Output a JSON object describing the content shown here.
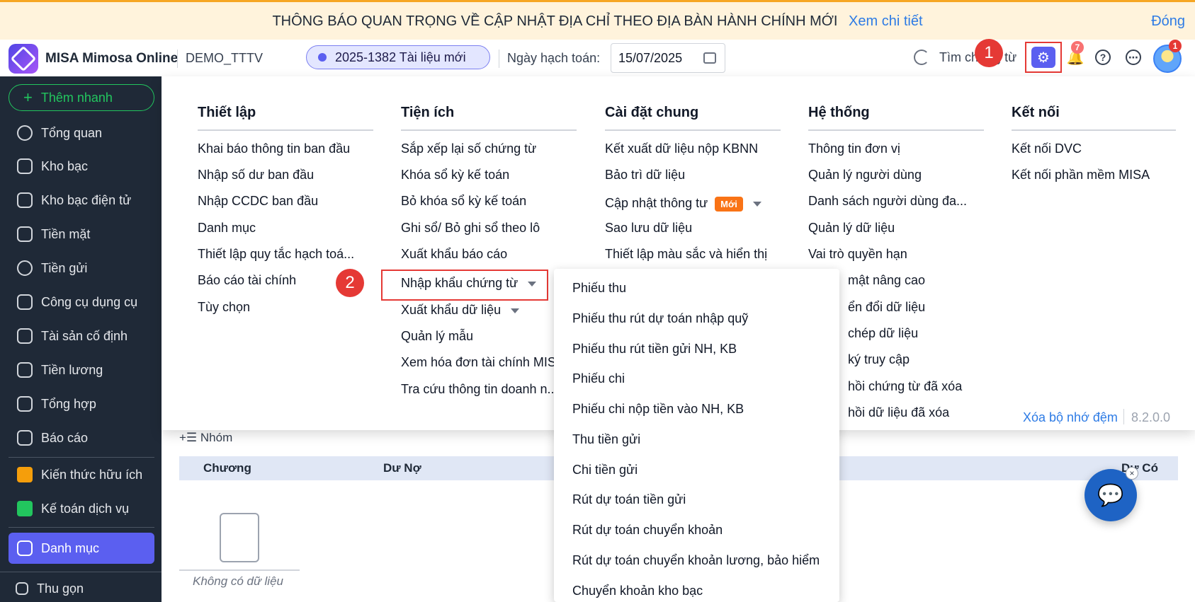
{
  "banner": {
    "message": "THÔNG BÁO QUAN TRỌNG VỀ CẬP NHẬT ĐỊA CHỈ THEO ĐỊA BÀN HÀNH CHÍNH MỚI",
    "link": "Xem chi tiết",
    "close": "Đóng"
  },
  "header": {
    "app_name": "MISA Mimosa Online",
    "database": "DEMO_TTTV",
    "doc_pill": "2025-1382 Tài liệu mới",
    "posting_date_label": "Ngày hạch toán:",
    "posting_date": "15/07/2025",
    "search_label": "Tìm chứng từ",
    "notification_count": "7",
    "avatar_count": "1",
    "step1": "1",
    "step2": "2"
  },
  "sidebar": {
    "add_quick": "Thêm nhanh",
    "items": [
      {
        "label": "Tổng quan"
      },
      {
        "label": "Kho bạc"
      },
      {
        "label": "Kho bạc điện tử"
      },
      {
        "label": "Tiền mặt"
      },
      {
        "label": "Tiền gửi"
      },
      {
        "label": "Công cụ dụng cụ"
      },
      {
        "label": "Tài sản cố định"
      },
      {
        "label": "Tiền lương"
      },
      {
        "label": "Tổng hợp"
      },
      {
        "label": "Báo cáo"
      },
      {
        "label": "Kiến thức hữu ích"
      },
      {
        "label": "Kế toán dịch vụ"
      },
      {
        "label": "Danh mục"
      }
    ],
    "collapse": "Thu gọn"
  },
  "background": {
    "group_label": "Nhóm",
    "columns": [
      "Chương",
      "Dư Nợ",
      "Dư Có"
    ],
    "empty_text": "Không có dữ liệu"
  },
  "settings_menu": {
    "columns": [
      {
        "title": "Thiết lập",
        "items": [
          "Khai báo thông tin ban đầu",
          "Nhập số dư ban đầu",
          "Nhập CCDC ban đầu",
          "Danh mục",
          "Thiết lập quy tắc hạch toá...",
          "Báo cáo tài chính",
          "Tùy chọn"
        ]
      },
      {
        "title": "Tiện ích",
        "items": [
          "Sắp xếp lại số chứng từ",
          "Khóa sổ kỳ kế toán",
          "Bỏ khóa sổ kỳ kế toán",
          "Ghi sổ/ Bỏ ghi sổ theo lô",
          "Xuất khẩu báo cáo",
          "Nhập khẩu chứng từ",
          "Xuất khẩu dữ liệu",
          "Quản lý mẫu",
          "Xem hóa đơn tài chính MIS",
          "Tra cứu thông tin doanh n..."
        ]
      },
      {
        "title": "Cài đặt chung",
        "items": [
          "Kết xuất dữ liệu nộp KBNN",
          "Bảo trì dữ liệu",
          "Cập nhật thông tư",
          "Sao lưu dữ liệu",
          "Thiết lập màu sắc và hiển thị"
        ],
        "new_tag": "Mới"
      },
      {
        "title": "Hệ thống",
        "items": [
          "Thông tin đơn vị",
          "Quản lý người dùng",
          "Danh sách người dùng đa...",
          "Quản lý dữ liệu",
          "Vai trò quyền hạn",
          "mật nâng cao",
          "ển đổi dữ liệu",
          "chép dữ liệu",
          "ký truy cập",
          "hồi chứng từ đã xóa",
          "hồi dữ liệu đã xóa"
        ]
      },
      {
        "title": "Kết nối",
        "items": [
          "Kết nối DVC",
          "Kết nối phần mềm MISA"
        ]
      }
    ],
    "clear_cache": "Xóa bộ nhớ đệm",
    "version": "8.2.0.0"
  },
  "import_submenu": {
    "items": [
      "Phiếu thu",
      "Phiếu thu rút dự toán nhập quỹ",
      "Phiếu thu rút tiền gửi NH, KB",
      "Phiếu chi",
      "Phiếu chi nộp tiền vào NH, KB",
      "Thu tiền gửi",
      "Chi tiền gửi",
      "Rút dự toán tiền gửi",
      "Rút dự toán chuyển khoản",
      "Rút dự toán chuyển khoản lương, bảo hiểm",
      "Chuyển khoản kho bạc"
    ]
  }
}
